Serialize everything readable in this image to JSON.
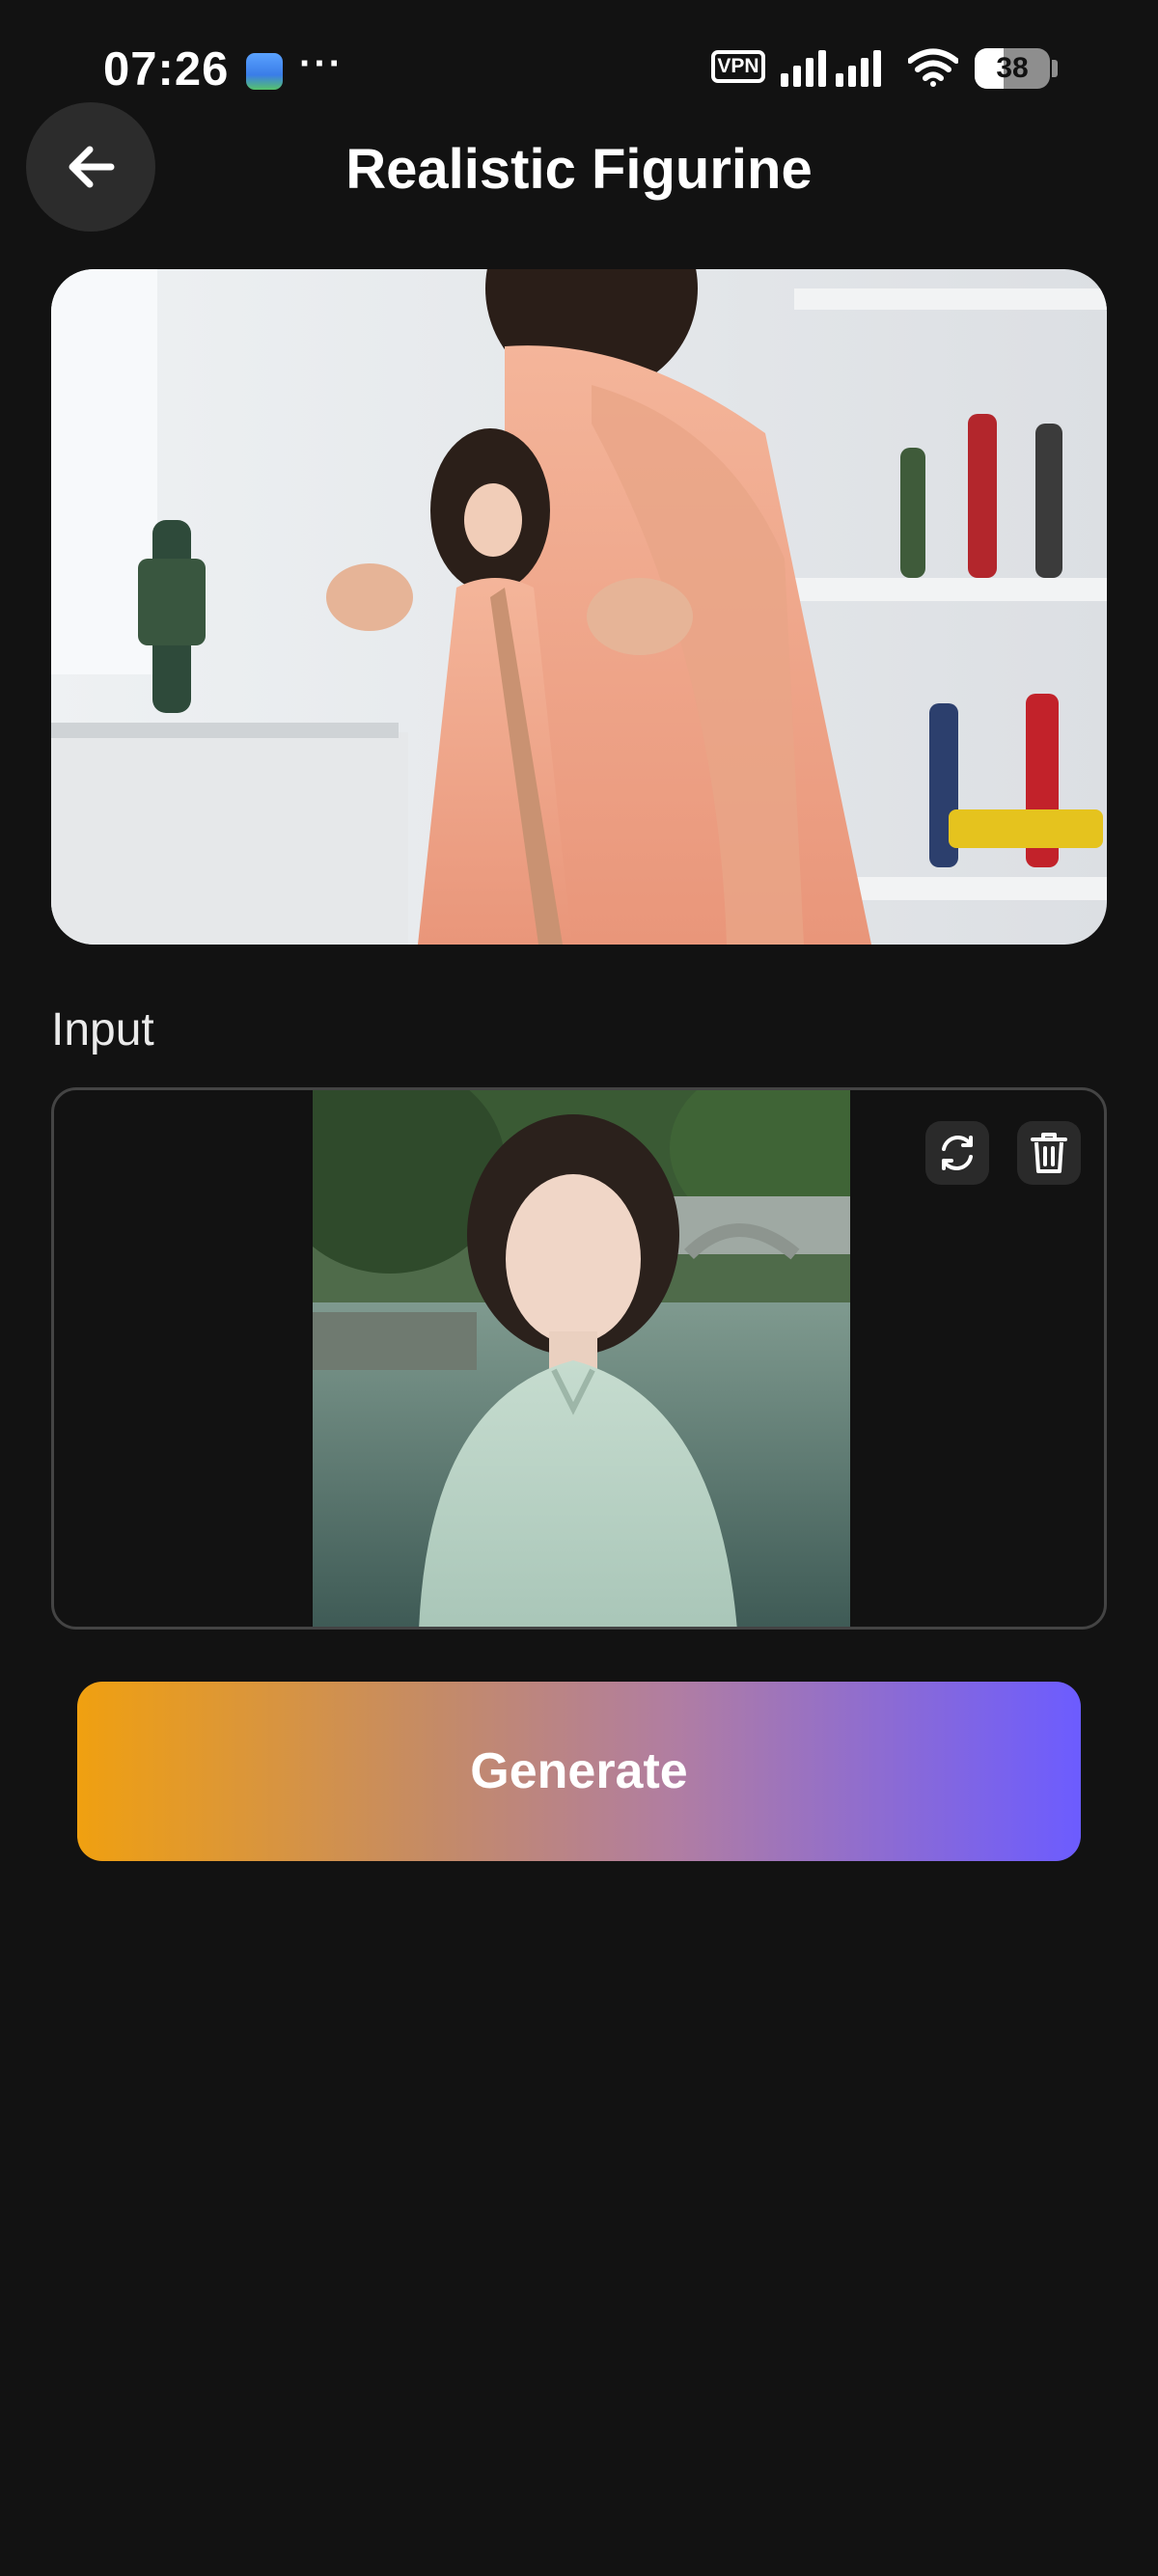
{
  "status_bar": {
    "time": "07:26",
    "more": "···",
    "vpn": "VPN",
    "battery": "38",
    "battery_level": 0.38,
    "icons": [
      "app-notification-icon",
      "vpn-icon",
      "signal-icon",
      "wifi-icon",
      "battery-icon"
    ]
  },
  "header": {
    "title": "Realistic Figurine",
    "back_icon": "arrow-left-icon"
  },
  "example": {
    "image_icon": "example-image"
  },
  "input": {
    "label": "Input",
    "actions": [
      "refresh-icon",
      "trash-icon"
    ]
  },
  "generate": {
    "label": "Generate"
  },
  "colors": {
    "background": "#121212",
    "surface": "#2c2c2c",
    "gradient_start": "#f0a010",
    "gradient_end": "#6c5cff"
  }
}
